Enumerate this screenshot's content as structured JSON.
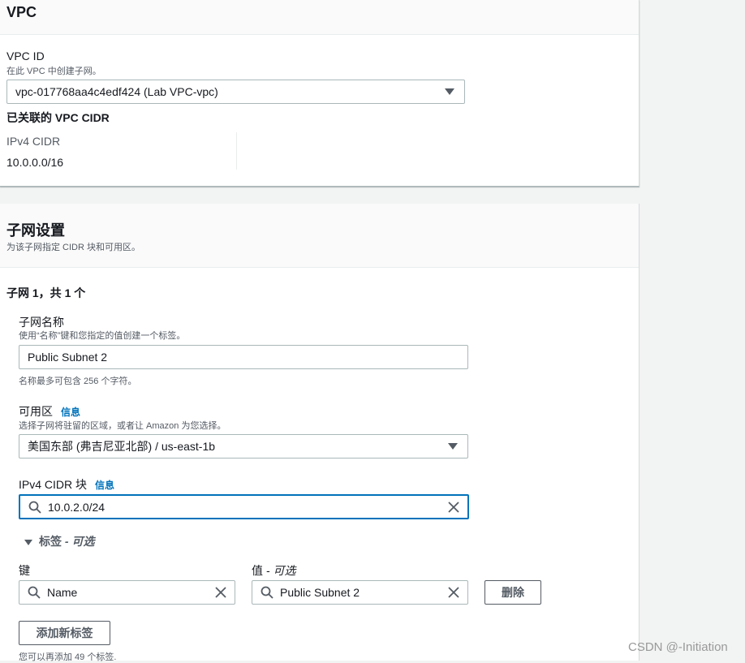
{
  "vpc_section": {
    "title": "VPC",
    "vpc_id_label": "VPC ID",
    "vpc_id_desc": "在此 VPC 中创建子网。",
    "vpc_id_value": "vpc-017768aa4c4edf424 (Lab VPC-vpc)",
    "cidr_heading": "已关联的 VPC CIDR",
    "ipv4_cidr_label": "IPv4 CIDR",
    "ipv4_cidr_value": "10.0.0.0/16"
  },
  "subnet_section": {
    "title": "子网设置",
    "desc": "为该子网指定 CIDR 块和可用区。",
    "subnet_counter": "子网 1，共 1 个",
    "name_label": "子网名称",
    "name_desc": "使用“名称”键和您指定的值创建一个标签。",
    "name_value": "Public Subnet 2",
    "name_hint": "名称最多可包含 256 个字符。",
    "az_label": "可用区",
    "az_info": "信息",
    "az_desc": "选择子网将驻留的区域，或者让 Amazon 为您选择。",
    "az_value": "美国东部 (弗吉尼亚北部) / us-east-1b",
    "cidr_label": "IPv4 CIDR 块",
    "cidr_info": "信息",
    "cidr_value": "10.0.2.0/24",
    "tags_toggle": "标签",
    "tags_optional": "- 可选",
    "key_label": "键",
    "value_label": "值",
    "value_optional": "- 可选",
    "tag_key": "Name",
    "tag_value": "Public Subnet 2",
    "remove_button": "删除",
    "add_tag_button": "添加新标签",
    "tags_remaining": "您可以再添加 49 个标签."
  },
  "watermark": "CSDN @-Initiation"
}
